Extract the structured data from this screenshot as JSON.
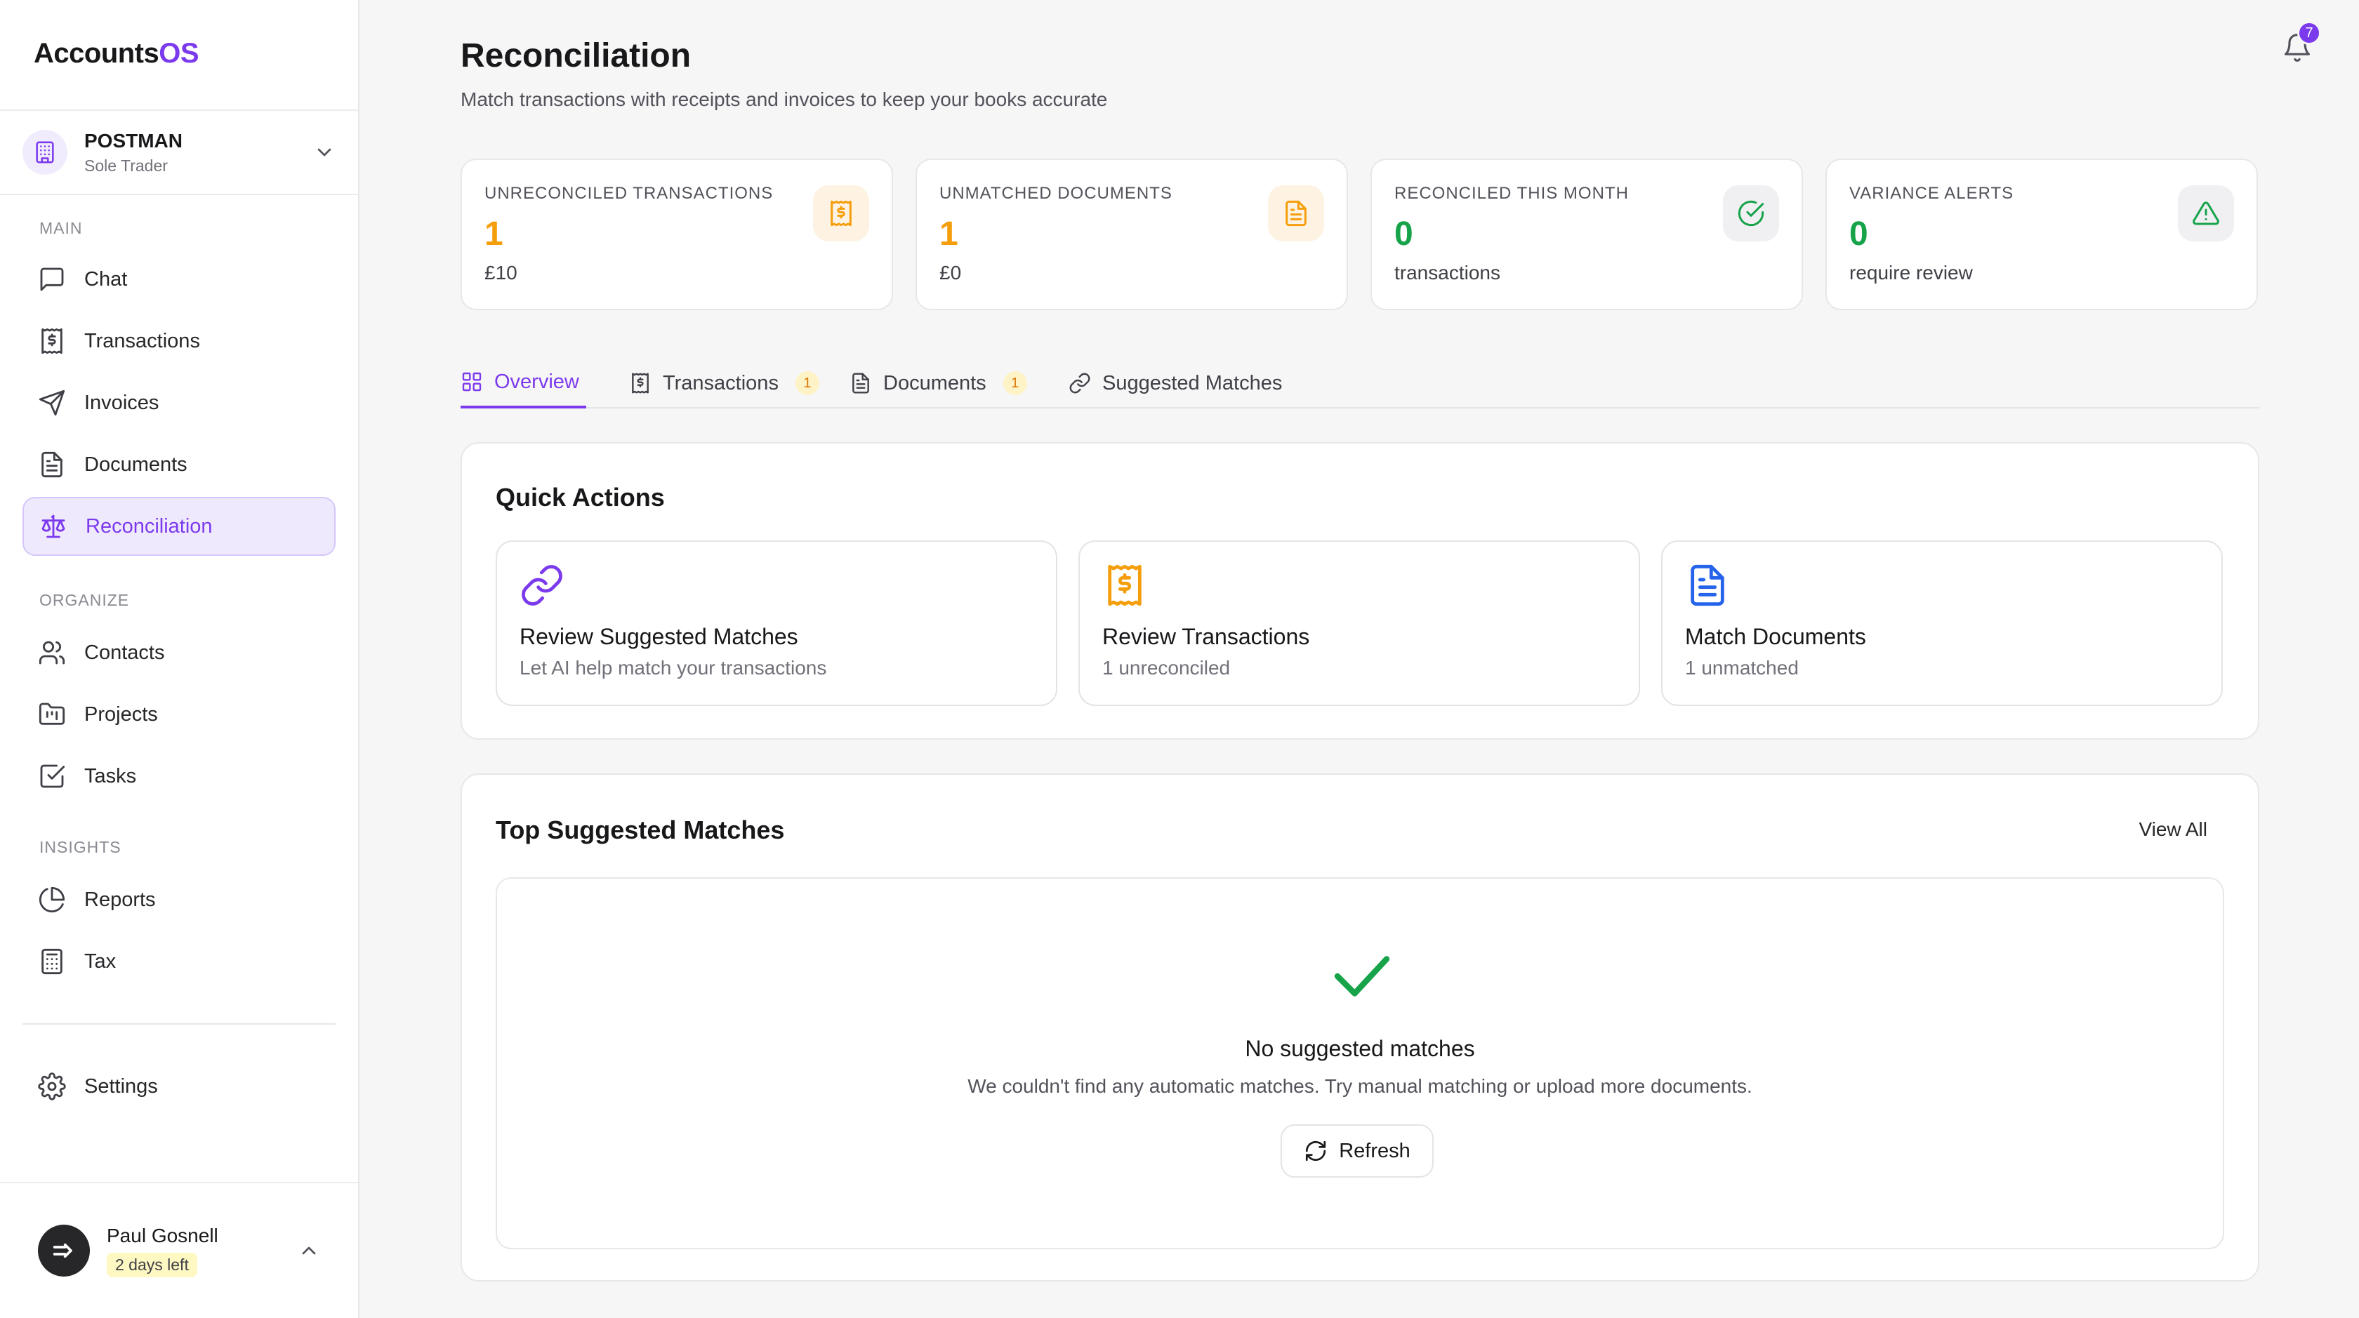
{
  "app": {
    "logo_main": "Accounts",
    "logo_accent": "OS"
  },
  "org": {
    "name": "POSTMAN",
    "type": "Sole Trader"
  },
  "sidebar": {
    "sections": [
      {
        "label": "MAIN"
      },
      {
        "label": "ORGANIZE"
      },
      {
        "label": "INSIGHTS"
      }
    ],
    "items": [
      {
        "label": "Chat",
        "icon": "chat-icon"
      },
      {
        "label": "Transactions",
        "icon": "receipt-dollar-icon"
      },
      {
        "label": "Invoices",
        "icon": "send-icon"
      },
      {
        "label": "Documents",
        "icon": "document-icon"
      },
      {
        "label": "Reconciliation",
        "icon": "scale-icon",
        "active": true
      },
      {
        "label": "Contacts",
        "icon": "users-icon"
      },
      {
        "label": "Projects",
        "icon": "folder-kanban-icon"
      },
      {
        "label": "Tasks",
        "icon": "checkbox-icon"
      },
      {
        "label": "Reports",
        "icon": "pie-chart-icon"
      },
      {
        "label": "Tax",
        "icon": "calculator-icon"
      },
      {
        "label": "Settings",
        "icon": "gear-icon"
      }
    ]
  },
  "user": {
    "name": "Paul Gosnell",
    "trial": "2 days left"
  },
  "header": {
    "title": "Reconciliation",
    "subtitle": "Match transactions with receipts and invoices to keep your books accurate",
    "notification_count": "7"
  },
  "stats": [
    {
      "label": "UNRECONCILED TRANSACTIONS",
      "value": "1",
      "sub": "£10",
      "icon": "receipt-dollar-icon",
      "color": "#f59e0b"
    },
    {
      "label": "UNMATCHED DOCUMENTS",
      "value": "1",
      "sub": "£0",
      "icon": "document-icon",
      "color": "#f59e0b"
    },
    {
      "label": "RECONCILED THIS MONTH",
      "value": "0",
      "sub": "transactions",
      "icon": "check-circle-icon",
      "color": "#16a34a"
    },
    {
      "label": "VARIANCE ALERTS",
      "value": "0",
      "sub": "require review",
      "icon": "alert-triangle-icon",
      "color": "#16a34a"
    }
  ],
  "tabs": [
    {
      "label": "Overview",
      "icon": "grid-icon",
      "active": true
    },
    {
      "label": "Transactions",
      "icon": "receipt-dollar-icon",
      "count": "1"
    },
    {
      "label": "Documents",
      "icon": "document-icon",
      "count": "1"
    },
    {
      "label": "Suggested Matches",
      "icon": "link-icon"
    }
  ],
  "quick_actions": {
    "title": "Quick Actions",
    "cards": [
      {
        "title": "Review Suggested Matches",
        "sub": "Let AI help match your transactions",
        "icon": "link-icon",
        "color": "#7c3aed"
      },
      {
        "title": "Review Transactions",
        "sub": "1 unreconciled",
        "icon": "receipt-dollar-icon",
        "color": "#f59e0b"
      },
      {
        "title": "Match Documents",
        "sub": "1 unmatched",
        "icon": "document-icon",
        "color": "#2563eb"
      }
    ]
  },
  "top_matches": {
    "title": "Top Suggested Matches",
    "view_all": "View All",
    "empty_title": "No suggested matches",
    "empty_desc": "We couldn't find any automatic matches. Try manual matching or upload more documents.",
    "refresh_label": "Refresh"
  }
}
